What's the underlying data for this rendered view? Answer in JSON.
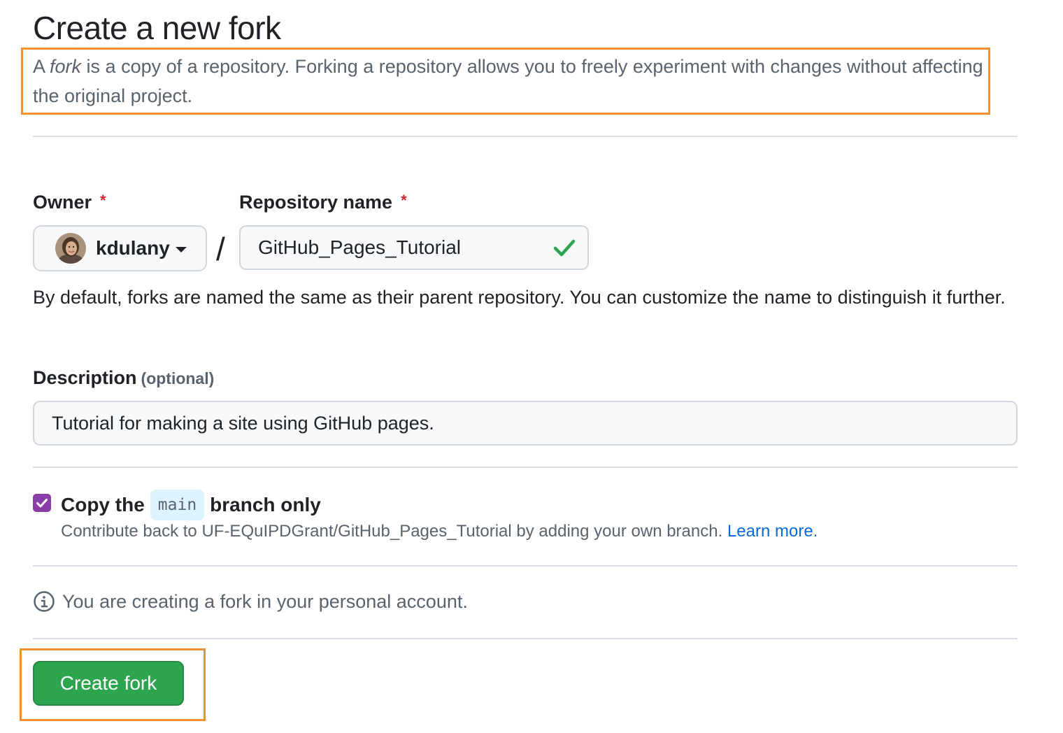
{
  "page": {
    "title": "Create a new fork",
    "intro": {
      "prefix": "A ",
      "emphasis": "fork",
      "suffix": " is a copy of a repository. Forking a repository allows you to freely experiment with changes without affecting the original project."
    }
  },
  "form": {
    "owner": {
      "label": "Owner",
      "required_mark": "*",
      "value": "kdulany"
    },
    "separator": "/",
    "repository": {
      "label": "Repository name",
      "required_mark": "*",
      "value": "GitHub_Pages_Tutorial",
      "valid": true
    },
    "name_help": "By default, forks are named the same as their parent repository. You can customize the name to distinguish it further.",
    "description": {
      "label": "Description",
      "optional_label": "(optional)",
      "value": "Tutorial for making a site using GitHub pages."
    },
    "copy_branch": {
      "checked": true,
      "label_before": "Copy the",
      "branch": "main",
      "label_after": "branch only",
      "help": "Contribute back to UF-EQuIPDGrant/GitHub_Pages_Tutorial by adding your own branch.",
      "learn_more": "Learn more."
    },
    "info_text": "You are creating a fork in your personal account.",
    "submit_label": "Create fork"
  },
  "colors": {
    "highlight_border": "#f0922d",
    "primary_button": "#2da44e",
    "checkbox": "#8a3ea8",
    "link": "#0969da",
    "required": "#d1242f",
    "check_icon": "#2da44e"
  },
  "icons": {
    "dropdown": "chevron-down-icon",
    "valid": "check-icon",
    "checkbox": "checkmark-icon",
    "info": "info-icon"
  }
}
